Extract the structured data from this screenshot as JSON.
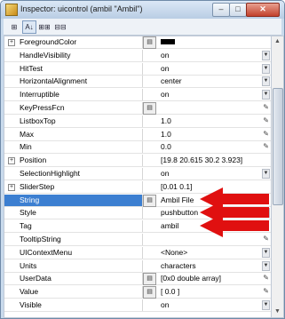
{
  "window": {
    "title": "Inspector:  uicontrol (ambil \"Ambil\")",
    "minimize_symbol": "–",
    "maximize_symbol": "□",
    "close_symbol": "✕"
  },
  "toolbar": {
    "buttons": [
      {
        "name": "categorize",
        "glyph": "⊞"
      },
      {
        "name": "sort-alpha",
        "glyph": "A↓"
      },
      {
        "name": "expand-all",
        "glyph": "⊞⊞"
      },
      {
        "name": "collapse-all",
        "glyph": "⊟⊟"
      }
    ]
  },
  "properties": [
    {
      "name": "ForegroundColor",
      "expandable": true,
      "value": "",
      "icon": "color-picker-icon",
      "control": "color"
    },
    {
      "name": "HandleVisibility",
      "value": "on",
      "control": "dropdown"
    },
    {
      "name": "HitTest",
      "value": "on",
      "control": "dropdown"
    },
    {
      "name": "HorizontalAlignment",
      "value": "center",
      "control": "dropdown"
    },
    {
      "name": "Interruptible",
      "value": "on",
      "control": "dropdown"
    },
    {
      "name": "KeyPressFcn",
      "value": "",
      "icon": "callback-icon",
      "control": "edit"
    },
    {
      "name": "ListboxTop",
      "value": "1.0",
      "control": "edit"
    },
    {
      "name": "Max",
      "value": "1.0",
      "control": "edit"
    },
    {
      "name": "Min",
      "value": "0.0",
      "control": "edit"
    },
    {
      "name": "Position",
      "expandable": true,
      "value": "[19.8 20.615 30.2 3.923]",
      "control": "none"
    },
    {
      "name": "SelectionHighlight",
      "value": "on",
      "control": "dropdown"
    },
    {
      "name": "SliderStep",
      "expandable": true,
      "value": "[0.01 0.1]",
      "control": "none"
    },
    {
      "name": "String",
      "value": "Ambil File",
      "icon": "text-editor-icon",
      "control": "edit",
      "selected": true
    },
    {
      "name": "Style",
      "value": "pushbutton",
      "control": "dropdown"
    },
    {
      "name": "Tag",
      "value": "ambil",
      "control": "edit"
    },
    {
      "name": "TooltipString",
      "value": "",
      "control": "edit"
    },
    {
      "name": "UIContextMenu",
      "value": "<None>",
      "control": "dropdown"
    },
    {
      "name": "Units",
      "value": "characters",
      "control": "dropdown"
    },
    {
      "name": "UserData",
      "value": "[0x0  double array]",
      "icon": "array-editor-icon",
      "control": "edit"
    },
    {
      "name": "Value",
      "value": "[ 0.0 ]",
      "icon": "value-editor-icon",
      "control": "edit"
    },
    {
      "name": "Visible",
      "value": "on",
      "control": "dropdown"
    }
  ],
  "glyphs": {
    "dropdown": "▼",
    "edit": "✎",
    "expand": "+",
    "scroll_up": "▲",
    "scroll_down": "▼"
  },
  "annotations": {
    "arrow_color": "#e01010",
    "arrow_count": 3
  },
  "colors": {
    "selection": "#3c7fd1",
    "foreground_swatch": "#000000"
  }
}
